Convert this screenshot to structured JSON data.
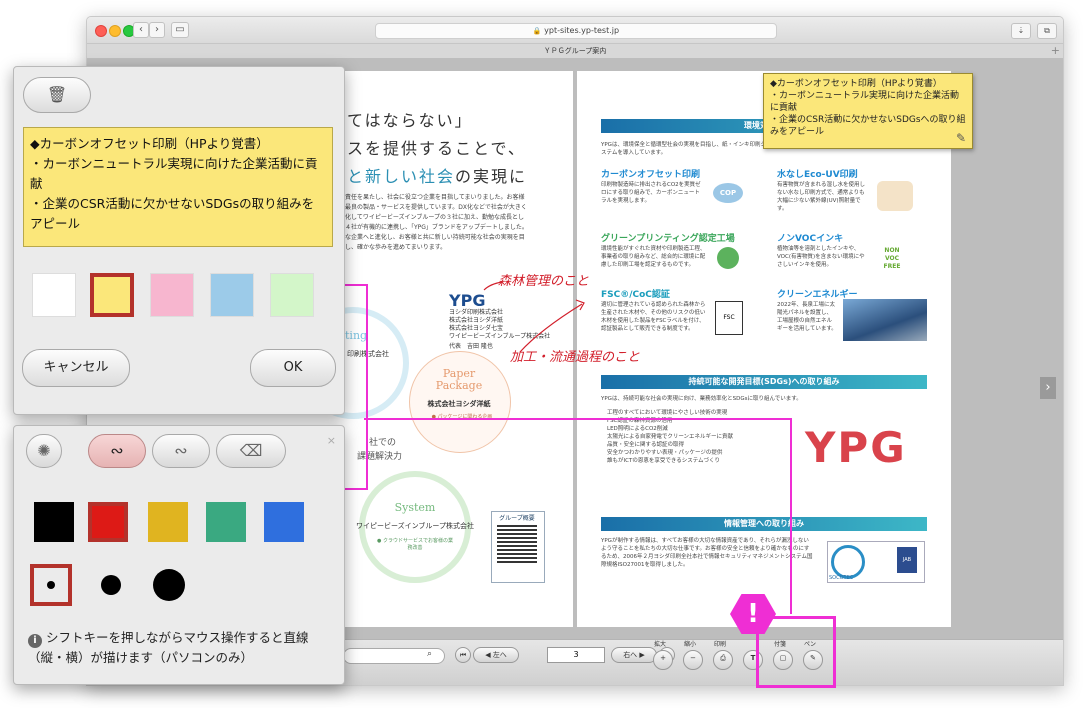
{
  "browser": {
    "url": "ypt-sites.yp-test.jp",
    "tab_title": "ＹＰＧグループ案内",
    "new_tab": "+"
  },
  "left_page": {
    "headline1": "てはならない」",
    "headline2": "スを提供することで、",
    "headline3_teal": "と新しい社会",
    "headline3_rest": "の実現に",
    "body": "の責任を果たし、社会に役立つ企業を目指してまいりました。お客様に最良の製品・サービスを提供しています。DX化などで社会が大きく変化してワイピービーズインブループの３社に加え、勤勉な成長とした４社が有機的に連携し、「YPG」ブランドをアップデートしました。様な企業へと進化し、お客様と共に新しい持続可能な社会の実現を目指し、確かな歩みを進めてまいります。",
    "ypg": "YPG",
    "companies": [
      "ヨシダ印刷株式会社",
      "株式会社ヨシダ洋紙",
      "株式会社ヨシダ七宝",
      "ワイピービーズインブループ株式会社"
    ],
    "rep": "代表　吉田 隆也",
    "paper_en1": "Paper",
    "paper_en2": "Package",
    "paper_jp": "株式会社ヨシダ洋紙",
    "paper_sub": "● パッケージに関わる企画",
    "system_en": "System",
    "system_jp": "ワイピービーズインブループ株式会社",
    "system_sub": "● クラウドサービスでお客様の業務改善",
    "left_circle_en": "ting",
    "left_circle_jp": "印刷株式会社",
    "center_text1": "社での",
    "center_text2": "課題解決力",
    "qr_title": "グループ概要",
    "hw_forest": "森林管理のこと",
    "hw_process": "加工・流通過程のこと"
  },
  "right_page": {
    "band1": "環境対応へ",
    "intro": "YPGは、環境保全と循環型社会の実現を目指し、紙・インキ印刷システムを導入しています。",
    "carbon_h": "カーボンオフセット印刷",
    "carbon_t": "印刷物製造時に排出されるCO2を実質ゼロにする取り組みで、カーボンニュートラルを実現します。",
    "cop": "COP",
    "green_h": "グリーンプリンティング認定工場",
    "green_t": "環境性能がすぐれた資材や印刷製造工程、事業者の取り組みなど、総合的に環境に配慮した印刷工場を認定するものです。",
    "fsc_h": "FSC®/CoC認証",
    "fsc_t": "適切に管理されている認められた森林から生産された木材や、その他のリスクの低い木材を使用した製品をFSCラベルを付け、認証製品として販売できる制度です。",
    "fsc": "FSC",
    "eco_h": "水なしEco-UV印刷",
    "eco_t": "有害物質が含まれる湿し水を使用しない水なし印刷方式で、通常よりも大幅に少ない紫外線(UV)照射量です。",
    "voc_h": "ノンVOCインキ",
    "voc_t": "植物油等を溶剤としたインキや、VOC(有害物質)を含まない環境にやさしいインキを使用。",
    "voc_badge": "NON VOC FREE",
    "clean_h": "クリーンエネルギー",
    "clean_t": "2022年、長泉工場に太陽光パネルを設置し、工場屋根の自然エネルギーを活用しています。",
    "band2": "持続可能な開発目標(SDGs)への取り組み",
    "sdgs_intro": "YPGは、持続可能な社会の実現に向け、業務効率化とSDGsに取り組んでいます。",
    "sdgs_list": [
      "工程のすべてにおいて環境にやさしい技術の実現",
      "FSC認証の森林資源の活用",
      "LED照明によるCO2削減",
      "太陽光による自家発電でクリーンエネルギーに貢献",
      "品質・安全に関する認証の取得",
      "安全かつわかりやすい表現・パッケージの提供",
      "誰もがICTの恩恵を享受できるシステムづくり"
    ],
    "big_ypg": "YPG",
    "band3": "情報管理への取り組み",
    "info_t": "YPGが制作する情報は、すべてお客様の大切な情報資産であり、それらが漏洩しないよう守ることを私たちの大切な仕事です。お客様の安全と信頼をより確かなものにするため、2006年２月ヨシダ印刷全社本社で情報セキュリティマネジメントシステム国際規格ISO27001を取得しました。",
    "socotec": "SOCOTEC",
    "jab": "JAB"
  },
  "sticky_note": {
    "line1": "◆カーボンオフセット印刷（HPより覚書）",
    "line2": "・カーボンニュートラル実現に向けた企業活動に貢献",
    "line3": "・企業のCSR活動に欠かせないSDGsへの取り組みをアピール"
  },
  "toolbar": {
    "labels": {
      "zoom_in": "拡大",
      "zoom_out": "縮小",
      "print": "印刷",
      "text": "",
      "sticky": "付箋",
      "pen": "ペン"
    },
    "prev_label": "◀ 左へ",
    "next_label": "右へ ▶",
    "page_value": "3"
  },
  "note_panel": {
    "text": "◆カーボンオフセット印刷（HPより覚書）\n・カーボンニュートラル実現に向けた企業活動に貢献\n・企業のCSR活動に欠かせないSDGsの取り組みをアピール",
    "colors": [
      "#ffffff",
      "#fbe77a",
      "#f7b6cf",
      "#9ccbe9",
      "#d3f6c9"
    ],
    "selected_color_index": 1,
    "cancel": "キャンセル",
    "ok": "OK"
  },
  "pen_panel": {
    "colors": [
      "#000000",
      "#dd1a16",
      "#e0b420",
      "#3aa981",
      "#2f6fde"
    ],
    "selected_color_index": 1,
    "selected_size_index": 0,
    "close": "×",
    "hint": "シフトキーを押しながらマウス操作すると直線（縦・横）が描けます（パソコンのみ）"
  },
  "annotation": {
    "mark": "!"
  }
}
